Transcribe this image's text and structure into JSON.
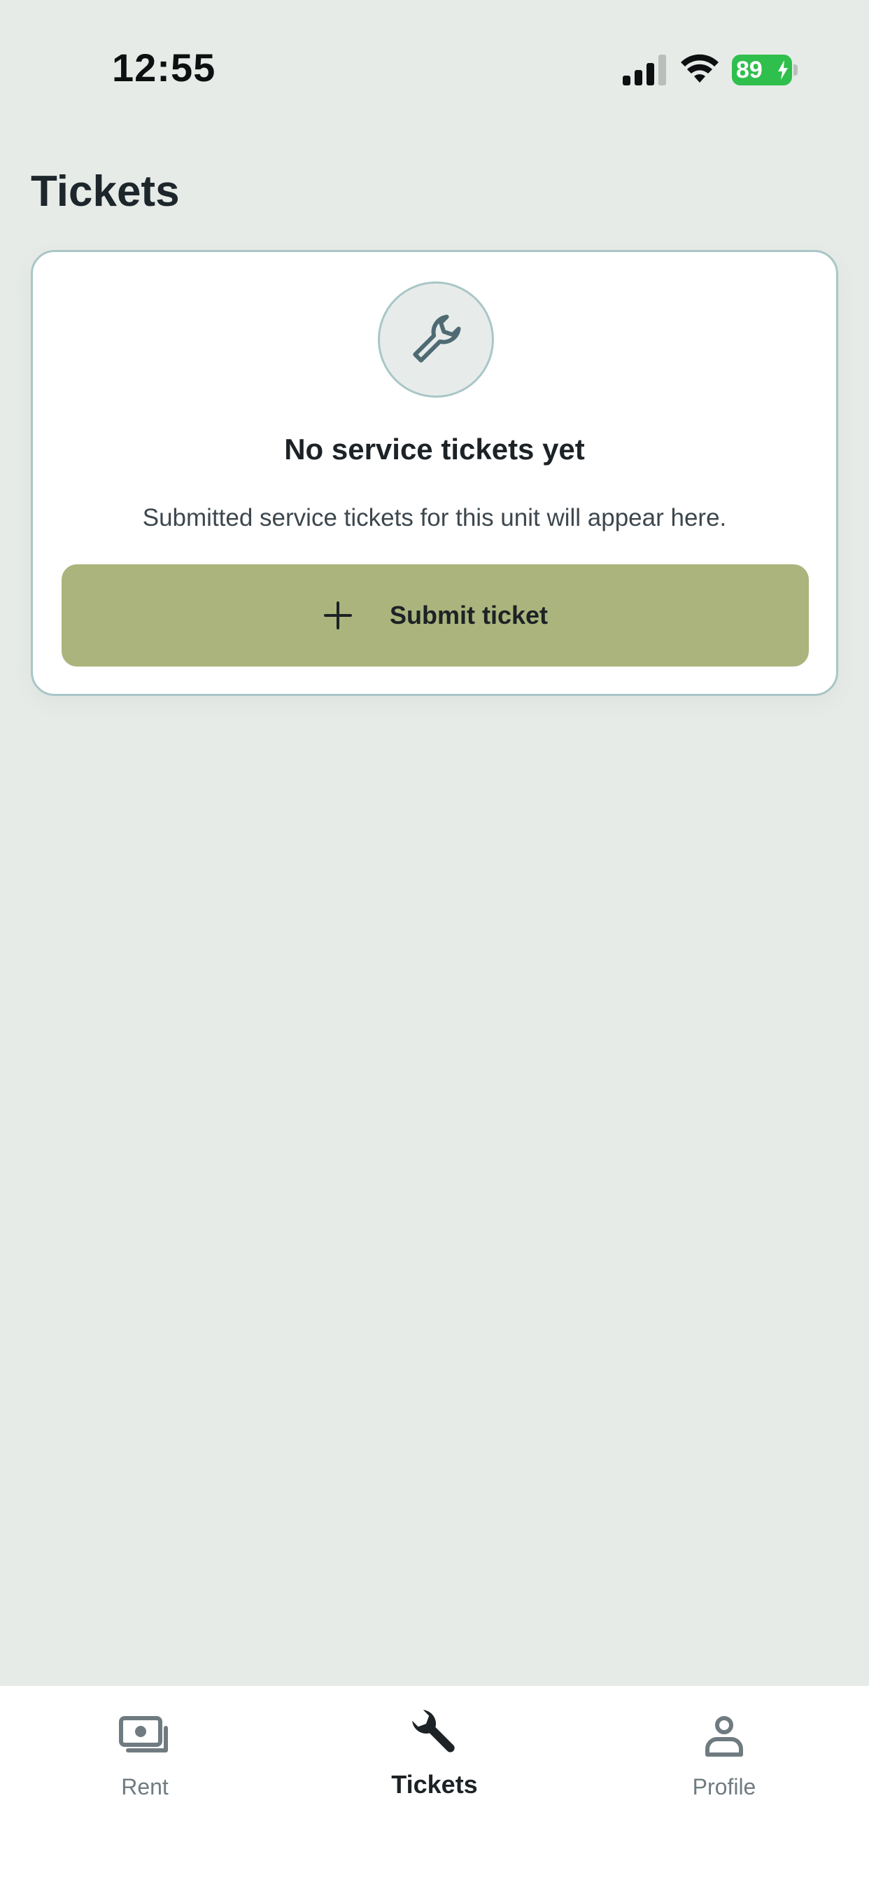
{
  "status_bar": {
    "time": "12:55",
    "battery": "89",
    "signal_icon": "cellular-signal-icon",
    "wifi_icon": "wifi-icon",
    "battery_color": "#2fbf4c"
  },
  "page": {
    "title": "Tickets"
  },
  "empty_state": {
    "icon": "wrench-icon",
    "title": "No service tickets yet",
    "subtitle": "Submitted service tickets for this unit will appear here.",
    "button_icon": "plus-icon",
    "button_label": "Submit ticket",
    "button_color": "#abb47c"
  },
  "tab_bar": {
    "tabs": [
      {
        "label": "Rent",
        "icon": "cash-icon",
        "active": false
      },
      {
        "label": "Tickets",
        "icon": "wrench-icon",
        "active": true
      },
      {
        "label": "Profile",
        "icon": "person-icon",
        "active": false
      }
    ]
  },
  "colors": {
    "background": "#e7ebe8",
    "card_border": "#a9c6c6",
    "text_primary": "#1c2226",
    "text_inactive": "#6f7b80"
  }
}
